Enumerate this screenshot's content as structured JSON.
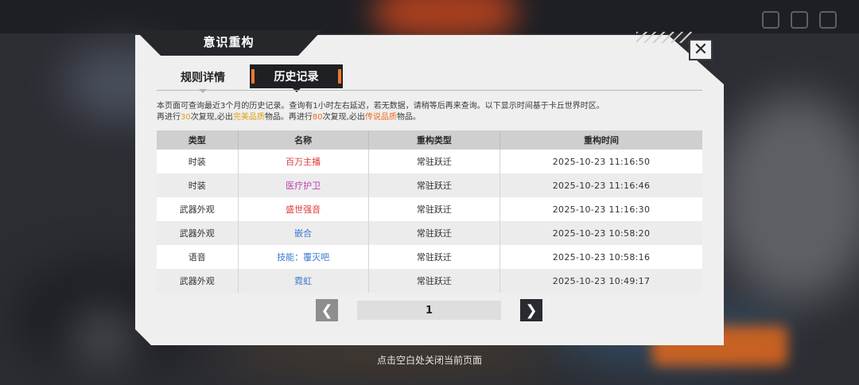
{
  "dialog": {
    "title": "意识重构",
    "close_icon": "close-icon"
  },
  "tabs": [
    {
      "label": "规则详情",
      "active": false
    },
    {
      "label": "历史记录",
      "active": true
    }
  ],
  "notice": {
    "line1": "本页面可查询最近3个月的历史记录。查询有1小时左右延迟，若无数据，请稍等后再来查询。以下显示时间基于卡丘世界时区。",
    "line2_a": "再进行",
    "line2_num1": "30",
    "line2_b": "次复现,必出",
    "line2_q1": "完美品质",
    "line2_c": "物品。再进行",
    "line2_num2": "80",
    "line2_d": "次复现,必出",
    "line2_q2": "传说品质",
    "line2_e": "物品。",
    "colors": {
      "perfect": "#e0a010",
      "legendary": "#f06a22"
    }
  },
  "table": {
    "headers": [
      "类型",
      "名称",
      "重构类型",
      "重构时间"
    ],
    "rows": [
      {
        "type": "时装",
        "name": "百万主播",
        "kind": "常驻跃迁",
        "time": "2025-10-23   11:16:50"
      },
      {
        "type": "时装",
        "name": "医疗护卫",
        "kind": "常驻跃迁",
        "time": "2025-10-23   11:16:46"
      },
      {
        "type": "武器外观",
        "name": "盛世强音",
        "kind": "常驻跃迁",
        "time": "2025-10-23   11:16:30"
      },
      {
        "type": "武器外观",
        "name": "嵌合",
        "kind": "常驻跃迁",
        "time": "2025-10-23   10:58:20"
      },
      {
        "type": "语音",
        "name": "技能：覆灭吧",
        "kind": "常驻跃迁",
        "time": "2025-10-23   10:58:16"
      },
      {
        "type": "武器外观",
        "name": "霓虹",
        "kind": "常驻跃迁",
        "time": "2025-10-23   10:49:17"
      }
    ],
    "name_colors": [
      "#e03a3a",
      "#c040b0",
      "#e03a3a",
      "#3a78d0",
      "#3a78d0",
      "#3a78d0"
    ]
  },
  "pagination": {
    "current_page": "1",
    "prev_icon": "chevron-left-icon",
    "next_icon": "chevron-right-icon"
  },
  "footer": {
    "hint": "点击空白处关闭当前页面"
  }
}
